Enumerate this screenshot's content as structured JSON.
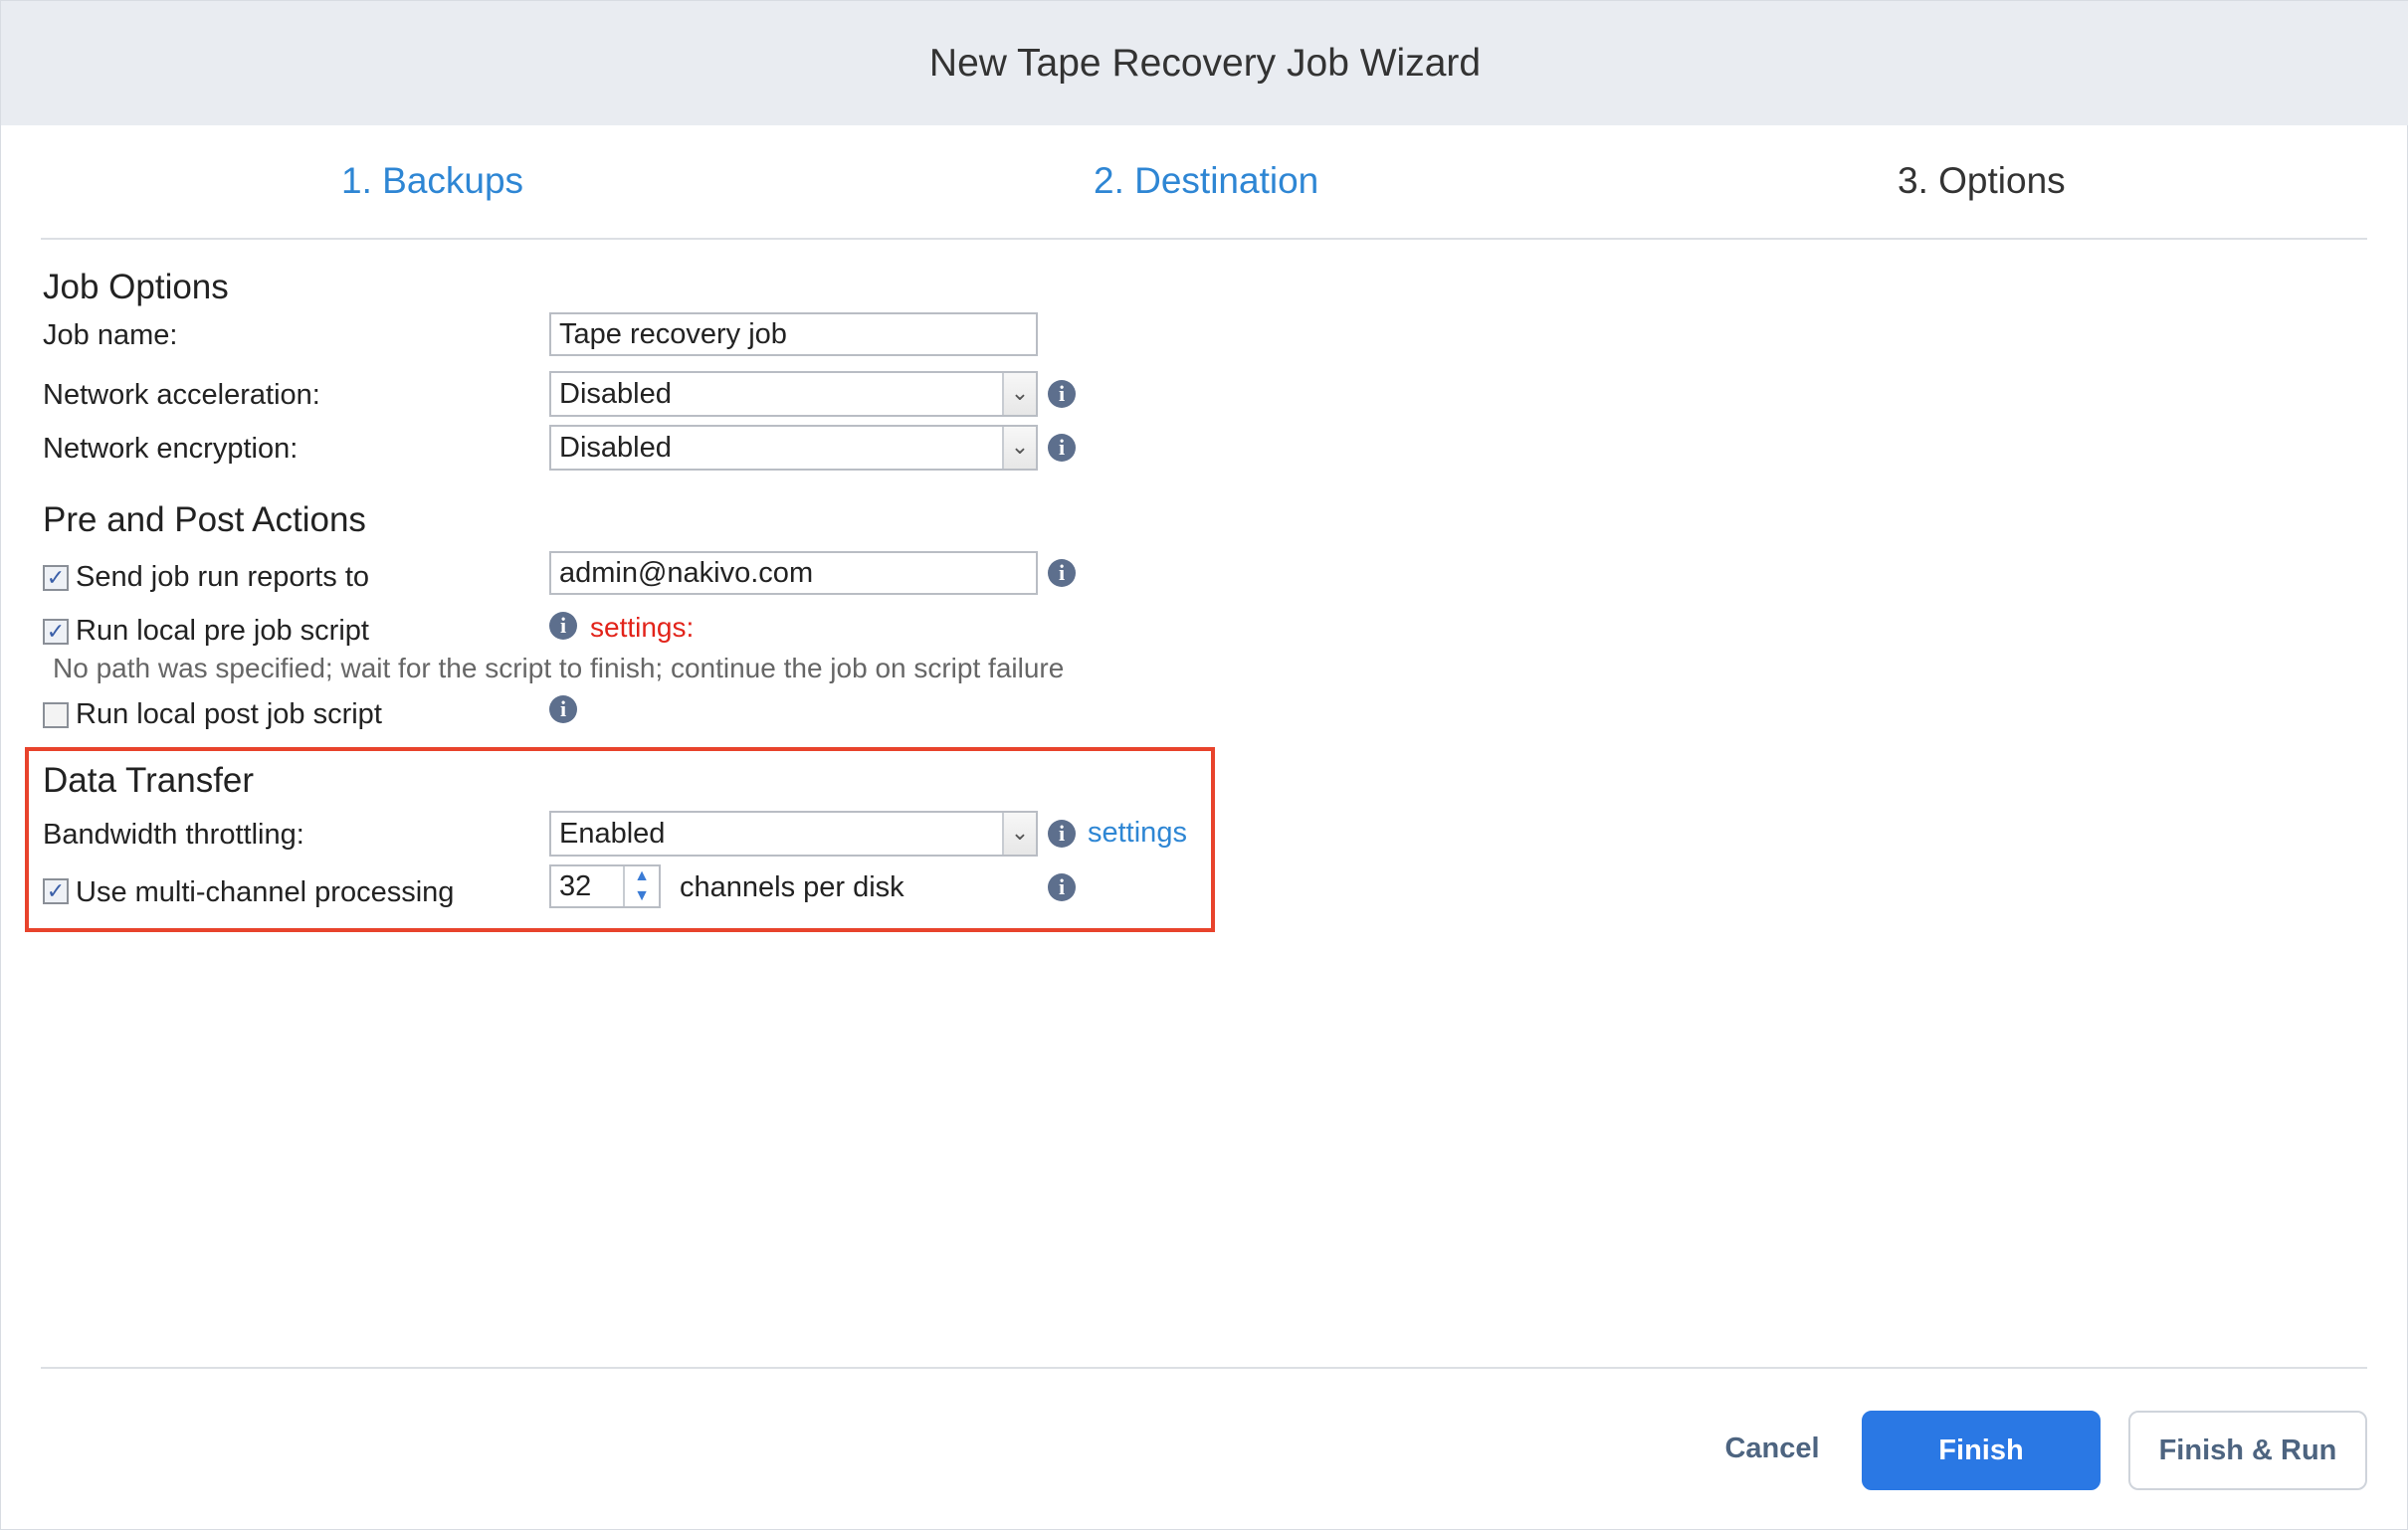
{
  "window": {
    "title": "New Tape Recovery Job Wizard"
  },
  "steps": [
    {
      "label": "1. Backups"
    },
    {
      "label": "2. Destination"
    },
    {
      "label": "3. Options"
    }
  ],
  "job_options": {
    "heading": "Job Options",
    "job_name_label": "Job name:",
    "job_name_value": "Tape recovery job",
    "net_accel_label": "Network acceleration:",
    "net_accel_value": "Disabled",
    "net_enc_label": "Network encryption:",
    "net_enc_value": "Disabled"
  },
  "pre_post": {
    "heading": "Pre and Post Actions",
    "send_reports_label": "Send job run reports to",
    "send_reports_checked": true,
    "send_reports_email": "admin@nakivo.com",
    "pre_script_label": "Run local pre job script",
    "pre_script_checked": true,
    "pre_script_settings": "settings:",
    "pre_script_note": "No path was specified; wait for the script to finish; continue the job on script failure",
    "post_script_label": "Run local post job script",
    "post_script_checked": false
  },
  "data_transfer": {
    "heading": "Data Transfer",
    "bandwidth_label": "Bandwidth throttling:",
    "bandwidth_value": "Enabled",
    "bandwidth_settings": "settings",
    "multichannel_label": "Use multi-channel processing",
    "multichannel_checked": true,
    "channels_value": "32",
    "channels_suffix": "channels per disk"
  },
  "footer": {
    "cancel_label": "Cancel",
    "finish_label": "Finish",
    "finish_run_label": "Finish & Run"
  },
  "icons": {
    "info": "info-icon",
    "dropdown": "chevron-down-icon",
    "check": "checkmark-icon"
  },
  "colors": {
    "link_blue": "#2e86d4",
    "primary_button": "#2a78e4",
    "highlight_red": "#e8432c",
    "error_red": "#e2231a",
    "title_bar": "#e9ecf1"
  }
}
